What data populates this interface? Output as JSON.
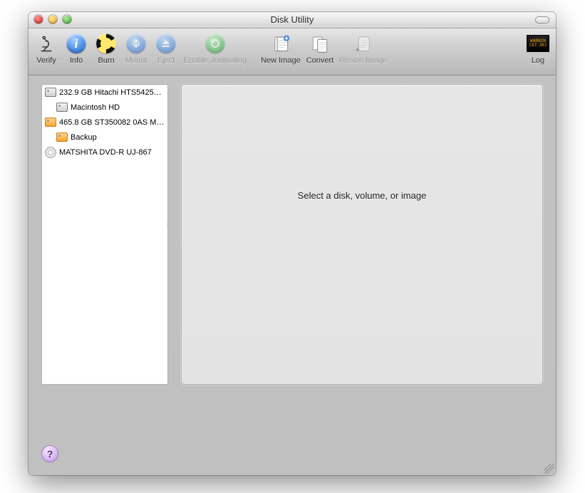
{
  "window": {
    "title": "Disk Utility"
  },
  "toolbar": {
    "items": [
      {
        "id": "verify",
        "label": "Verify",
        "enabled": true
      },
      {
        "id": "info",
        "label": "Info",
        "enabled": true
      },
      {
        "id": "burn",
        "label": "Burn",
        "enabled": true
      },
      {
        "id": "mount",
        "label": "Mount",
        "enabled": false
      },
      {
        "id": "eject",
        "label": "Eject",
        "enabled": false
      },
      {
        "id": "enable-journaling",
        "label": "Enable Journaling",
        "enabled": false
      },
      {
        "id": "new-image",
        "label": "New Image",
        "enabled": true
      },
      {
        "id": "convert",
        "label": "Convert",
        "enabled": true
      },
      {
        "id": "resize-image",
        "label": "Resize Image",
        "enabled": false
      }
    ],
    "log_label": "Log",
    "log_lines": {
      "a": "WARNIN",
      "b": "(X7.36)"
    }
  },
  "sidebar": {
    "items": [
      {
        "label": "232.9 GB Hitachi HTS5425…",
        "icon": "hdd",
        "indent": false
      },
      {
        "label": "Macintosh HD",
        "icon": "hdd",
        "indent": true
      },
      {
        "label": "465.8 GB ST350082 0AS M…",
        "icon": "hdd-orange",
        "indent": false
      },
      {
        "label": "Backup",
        "icon": "hdd-orange",
        "indent": true
      },
      {
        "label": "MATSHITA DVD-R UJ-867",
        "icon": "disc",
        "indent": false
      }
    ]
  },
  "main": {
    "prompt": "Select a disk, volume, or image"
  }
}
